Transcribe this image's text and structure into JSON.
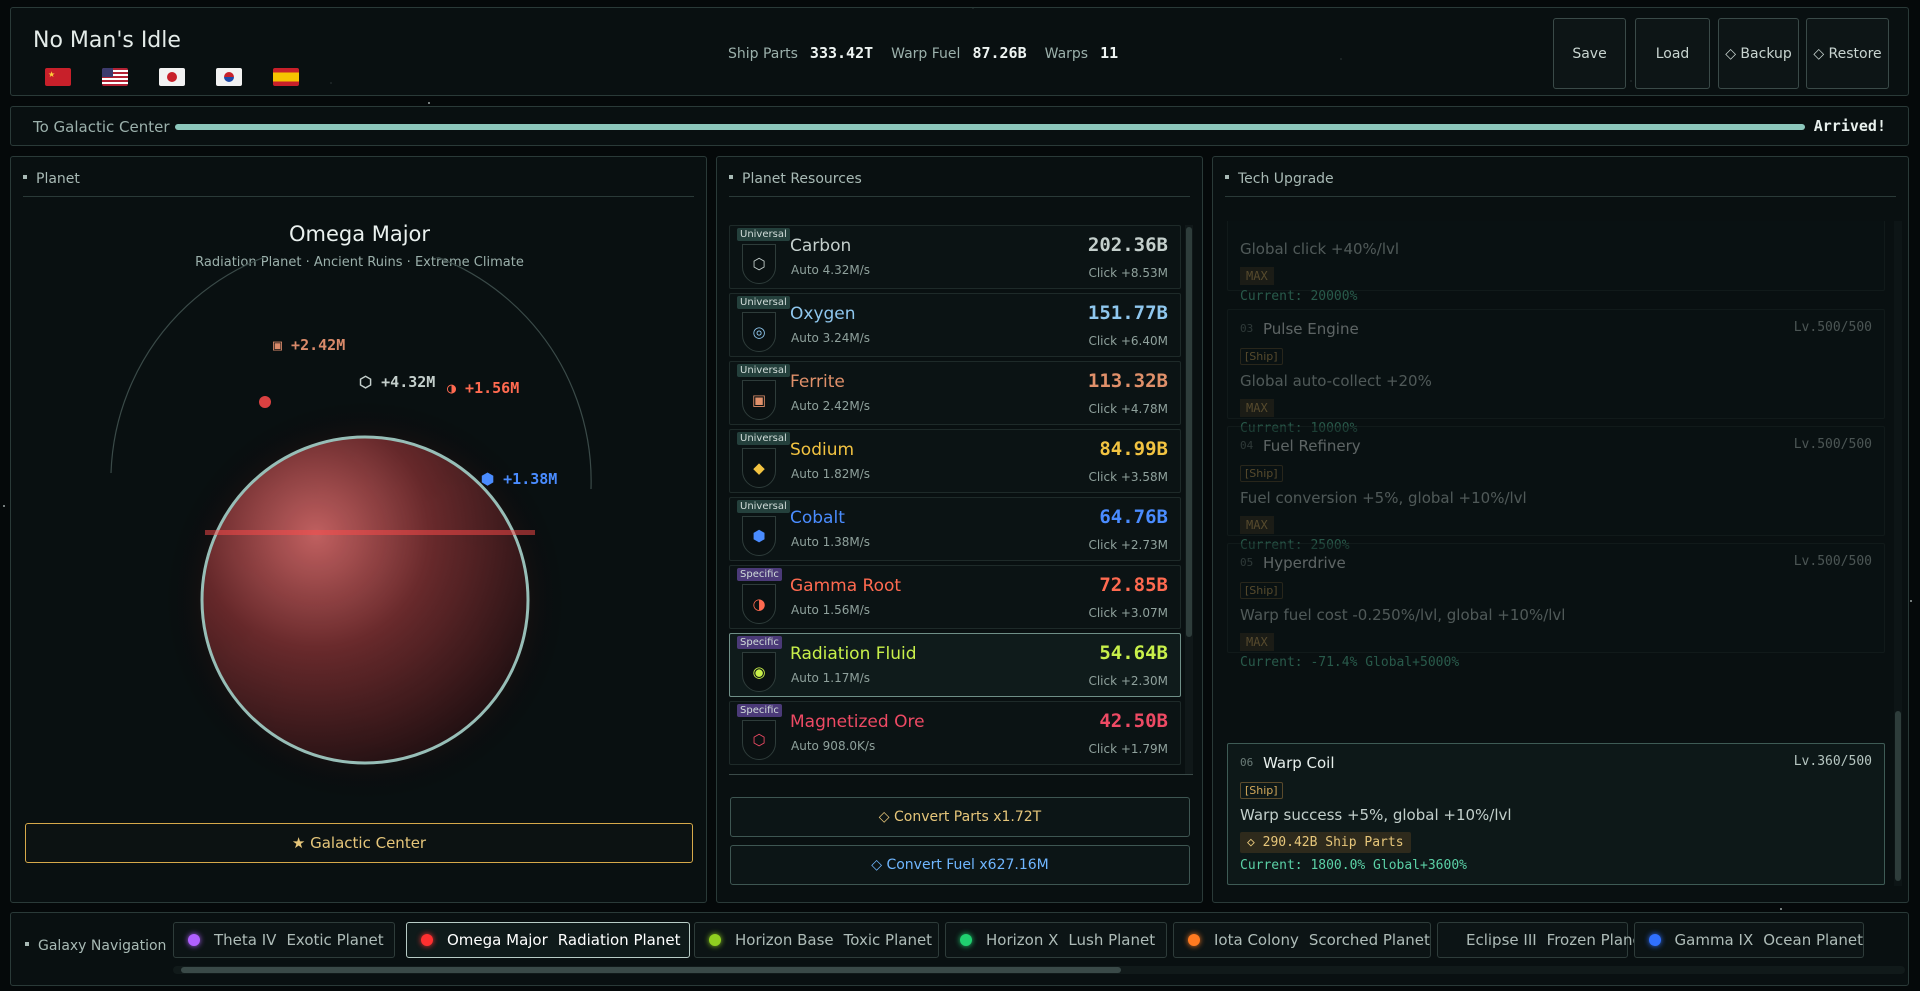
{
  "app": {
    "title": "No Man's Idle",
    "languages": [
      "cn",
      "us",
      "jp",
      "kr",
      "es"
    ]
  },
  "stats": {
    "ship_parts_label": "Ship Parts",
    "ship_parts_value": "333.42T",
    "warp_fuel_label": "Warp Fuel",
    "warp_fuel_value": "87.26B",
    "warps_label": "Warps",
    "warps_value": "11"
  },
  "buttons": {
    "save": "Save",
    "load": "Load",
    "backup": "◇ Backup",
    "restore": "◇ Restore"
  },
  "progress": {
    "label": "To Galactic Center",
    "status": "Arrived!",
    "fraction": 1.0
  },
  "planet": {
    "header": "Planet",
    "name": "Omega Major",
    "subtitle": "Radiation Planet · Ancient Ruins · Extreme Climate",
    "floats": [
      {
        "icon": "▣",
        "text": "+2.42M",
        "color": "#d98a6a"
      },
      {
        "icon": "⬡",
        "text": "+4.32M",
        "color": "#c4cfcc"
      },
      {
        "icon": "◑",
        "text": "+1.56M",
        "color": "#ff6a50"
      },
      {
        "icon": "⬢",
        "text": "+1.38M",
        "color": "#4a8cff"
      }
    ],
    "galactic_center_button": "★ Galactic Center"
  },
  "resources": {
    "header": "Planet Resources",
    "items": [
      {
        "badge": "Universal",
        "icon": "⬡",
        "name": "Carbon",
        "auto": "Auto 4.32M/s",
        "value": "202.36B",
        "click": "Click +8.53M",
        "color": "#c4cfcc"
      },
      {
        "badge": "Universal",
        "icon": "◎",
        "name": "Oxygen",
        "auto": "Auto 3.24M/s",
        "value": "151.77B",
        "click": "Click +6.40M",
        "color": "#8fc7ee"
      },
      {
        "badge": "Universal",
        "icon": "▣",
        "name": "Ferrite",
        "auto": "Auto 2.42M/s",
        "value": "113.32B",
        "click": "Click +4.78M",
        "color": "#e0906a"
      },
      {
        "badge": "Universal",
        "icon": "◆",
        "name": "Sodium",
        "auto": "Auto 1.82M/s",
        "value": "84.99B",
        "click": "Click +3.58M",
        "color": "#f2c341"
      },
      {
        "badge": "Universal",
        "icon": "⬢",
        "name": "Cobalt",
        "auto": "Auto 1.38M/s",
        "value": "64.76B",
        "click": "Click +2.73M",
        "color": "#4a8cff"
      },
      {
        "badge": "Specific",
        "icon": "◑",
        "name": "Gamma Root",
        "auto": "Auto 1.56M/s",
        "value": "72.85B",
        "click": "Click +3.07M",
        "color": "#ff6a50"
      },
      {
        "badge": "Specific",
        "icon": "◉",
        "name": "Radiation Fluid",
        "auto": "Auto 1.17M/s",
        "value": "54.64B",
        "click": "Click +2.30M",
        "color": "#c8f04a"
      },
      {
        "badge": "Specific",
        "icon": "⬡",
        "name": "Magnetized Ore",
        "auto": "Auto 908.0K/s",
        "value": "42.50B",
        "click": "Click +1.79M",
        "color": "#ee4a64"
      }
    ],
    "convert_parts": "◇ Convert Parts x1.72T",
    "convert_fuel": "◇ Convert Fuel x627.16M"
  },
  "tech": {
    "header": "Tech Upgrade",
    "partial": {
      "desc": "Global click +40%/lvl",
      "max": "MAX",
      "current": "Current: 20000%"
    },
    "items": [
      {
        "num": "03",
        "name": "Pulse Engine",
        "level": "Lv.500/500",
        "tag": "[Ship]",
        "desc": "Global auto-collect +20%",
        "max": "MAX",
        "current": "Current: 10000%"
      },
      {
        "num": "04",
        "name": "Fuel Refinery",
        "level": "Lv.500/500",
        "tag": "[Ship]",
        "desc": "Fuel conversion +5%, global +10%/lvl",
        "max": "MAX",
        "current": "Current: 2500%"
      },
      {
        "num": "05",
        "name": "Hyperdrive",
        "level": "Lv.500/500",
        "tag": "[Ship]",
        "desc": "Warp fuel cost -0.250%/lvl, global +10%/lvl",
        "max": "MAX",
        "current": "Current: -71.4% Global+5000%"
      }
    ],
    "active": {
      "num": "06",
      "name": "Warp Coil",
      "level": "Lv.360/500",
      "tag": "[Ship]",
      "desc": "Warp success +5%, global +10%/lvl",
      "cost": "◇ 290.42B Ship Parts",
      "current": "Current: 1800.0% Global+3600%"
    }
  },
  "nav": {
    "label": "Galaxy Navigation",
    "planets": [
      {
        "name": "Theta IV",
        "type": "Exotic Planet",
        "color": "#b060ff",
        "active": false
      },
      {
        "name": "Omega Major",
        "type": "Radiation Planet",
        "color": "#ff3030",
        "active": true
      },
      {
        "name": "Horizon Base",
        "type": "Toxic Planet",
        "color": "#90d020",
        "active": false
      },
      {
        "name": "Horizon X",
        "type": "Lush Planet",
        "color": "#20d070",
        "active": false
      },
      {
        "name": "Iota Colony",
        "type": "Scorched Planet",
        "color": "#ff7a20",
        "active": false
      },
      {
        "name": "Eclipse III",
        "type": "Frozen Planet",
        "color": "#50b8ff",
        "active": false
      },
      {
        "name": "Gamma IX",
        "type": "Ocean Planet",
        "color": "#3070ff",
        "active": false
      }
    ]
  }
}
